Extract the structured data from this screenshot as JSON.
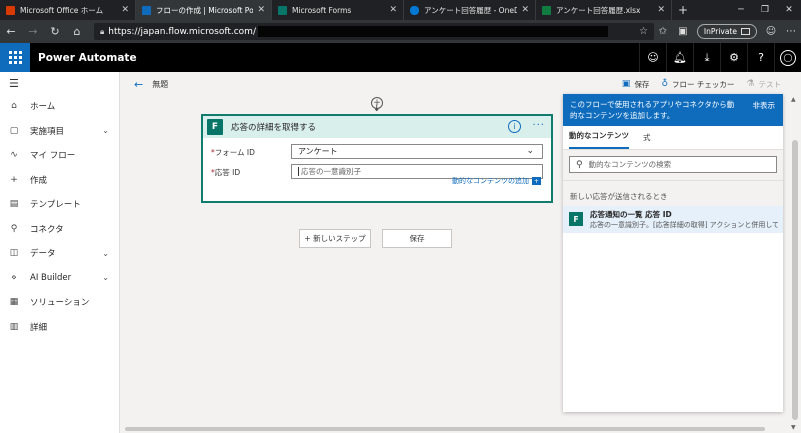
{
  "browser": {
    "tabs": [
      {
        "label": "Microsoft Office ホーム",
        "icon_color": "#d83b01"
      },
      {
        "label": "フローの作成 | Microsoft Power Automate",
        "icon_color": "#0f6cbd"
      },
      {
        "label": "Microsoft Forms",
        "icon_color": "#077568"
      },
      {
        "label": "アンケート回答履歴 - OneDrive",
        "icon_color": "#0078d4"
      },
      {
        "label": "アンケート回答履歴.xlsx",
        "icon_color": "#107c41"
      }
    ],
    "url": "https://japan.flow.microsoft.com/",
    "inprivate_label": "InPrivate"
  },
  "app": {
    "name": "Power Automate"
  },
  "leftnav": {
    "items": [
      {
        "label": "ホーム",
        "icon": "home-icon",
        "glyph": "⌂",
        "expandable": false
      },
      {
        "label": "実施項目",
        "icon": "action-items-icon",
        "glyph": "▢",
        "expandable": true
      },
      {
        "label": "マイ フロー",
        "icon": "flow-icon",
        "glyph": "∿",
        "expandable": false
      },
      {
        "label": "作成",
        "icon": "create-icon",
        "glyph": "+",
        "expandable": false
      },
      {
        "label": "テンプレート",
        "icon": "template-icon",
        "glyph": "▤",
        "expandable": false
      },
      {
        "label": "コネクタ",
        "icon": "connector-icon",
        "glyph": "⚲",
        "expandable": false
      },
      {
        "label": "データ",
        "icon": "data-icon",
        "glyph": "◫",
        "expandable": true
      },
      {
        "label": "AI Builder",
        "icon": "ai-builder-icon",
        "glyph": "⋄",
        "expandable": true
      },
      {
        "label": "ソリューション",
        "icon": "solution-icon",
        "glyph": "▦",
        "expandable": false
      },
      {
        "label": "詳細",
        "icon": "learn-icon",
        "glyph": "▥",
        "expandable": false
      }
    ]
  },
  "cmdbar": {
    "flow_title": "無題",
    "save_label": "保存",
    "checker_label": "フロー チェッカー",
    "test_label": "テスト"
  },
  "card": {
    "title": "応答の詳細を取得する",
    "form_id_label": "フォーム ID",
    "form_id_value": "アンケート",
    "response_id_label": "応答 ID",
    "response_id_placeholder": "応答の一意識別子",
    "dynamic_link_label": "動的なコンテンツの追加"
  },
  "canvas": {
    "new_step_label": "+ 新しいステップ",
    "save_label": "保存"
  },
  "dynpanel": {
    "header_text": "このフローで使用されるアプリやコネクタから動的なコンテンツを追加します。",
    "hide_label": "非表示",
    "tab_dynamic": "動的なコンテンツ",
    "tab_expression": "式",
    "search_placeholder": "動的なコンテンツの検索",
    "section_title": "新しい応答が送信されるとき",
    "item_title": "応答通知の一覧 応答 ID",
    "item_desc": "応答の一意識別子。[応答詳細の取得] アクションと併用してください。"
  },
  "colors": {
    "accent": "#0f6cbd",
    "forms_teal": "#077568",
    "card_border": "#107c6e"
  }
}
